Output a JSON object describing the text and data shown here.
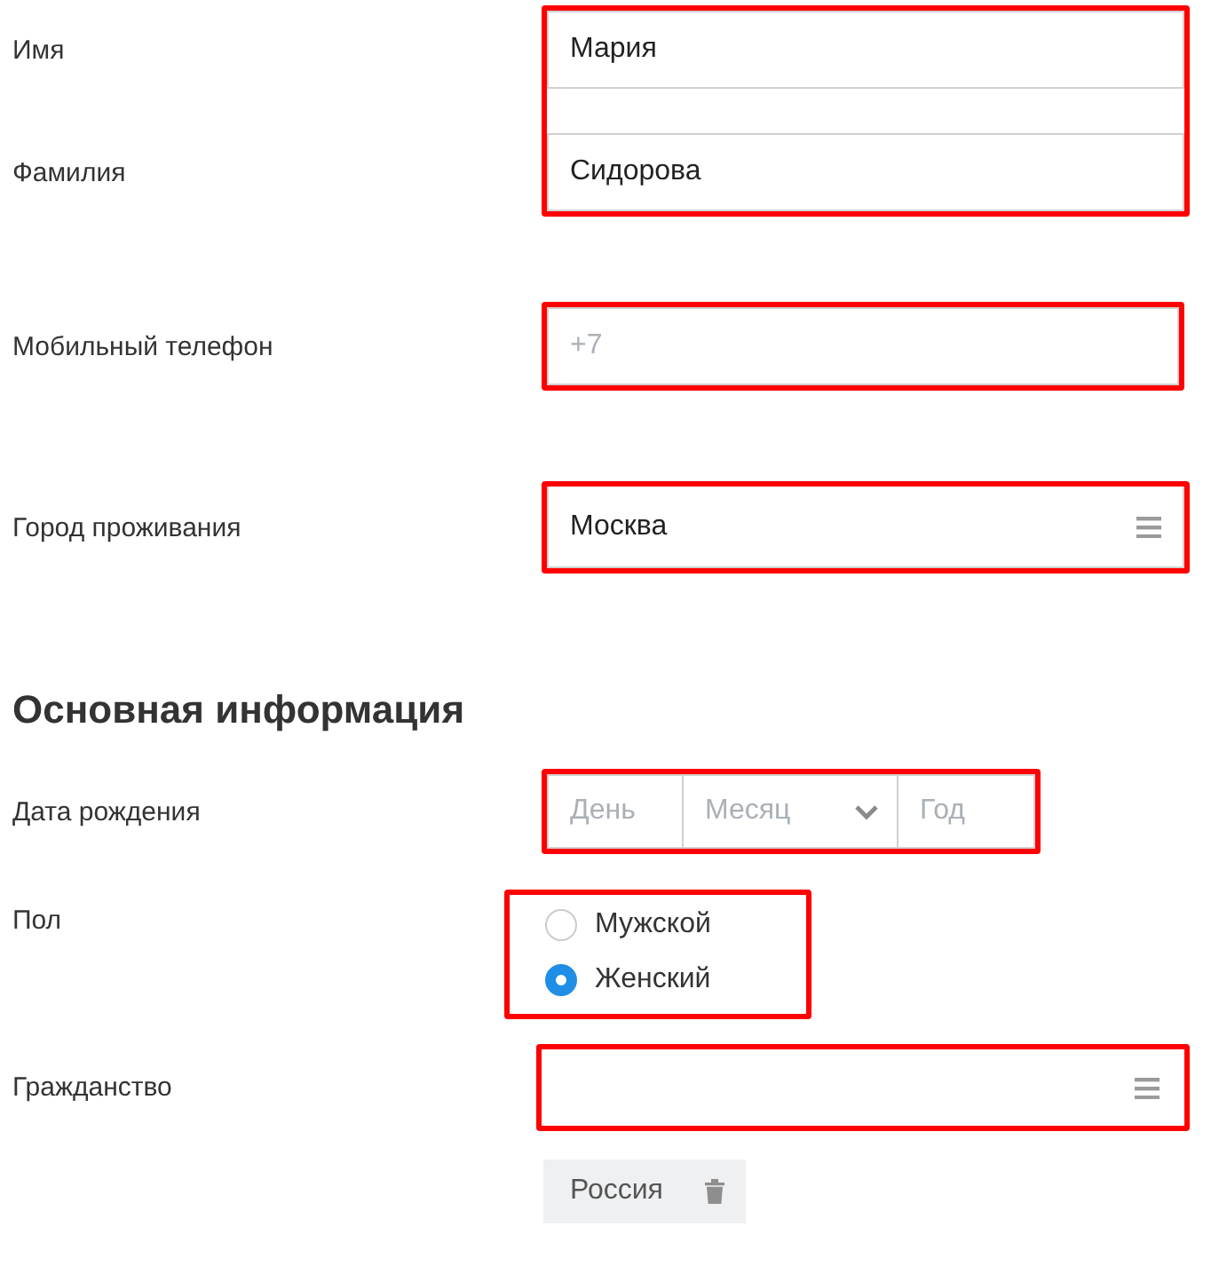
{
  "name_block": {
    "highlighted": true,
    "fields": [
      {
        "label": "Имя",
        "value": "Мария"
      },
      {
        "label": "Фамилия",
        "value": "Сидорова"
      }
    ]
  },
  "phone": {
    "label": "Мобильный телефон",
    "placeholder": "+7",
    "highlighted": true
  },
  "city": {
    "label": "Город проживания",
    "value": "Москва",
    "highlighted": true
  },
  "section_title": "Основная информация",
  "birth_date": {
    "label": "Дата рождения",
    "highlighted": true,
    "parts": [
      {
        "placeholder": "День",
        "kind": "text"
      },
      {
        "placeholder": "Месяц",
        "kind": "select"
      },
      {
        "placeholder": "Год",
        "kind": "text"
      }
    ]
  },
  "gender": {
    "label": "Пол",
    "highlighted": true,
    "options": [
      {
        "label": "Мужской",
        "selected": false
      },
      {
        "label": "Женский",
        "selected": true
      }
    ]
  },
  "citizenship": {
    "label": "Гражданство",
    "highlighted": true,
    "chips": [
      {
        "label": "Россия"
      }
    ]
  }
}
